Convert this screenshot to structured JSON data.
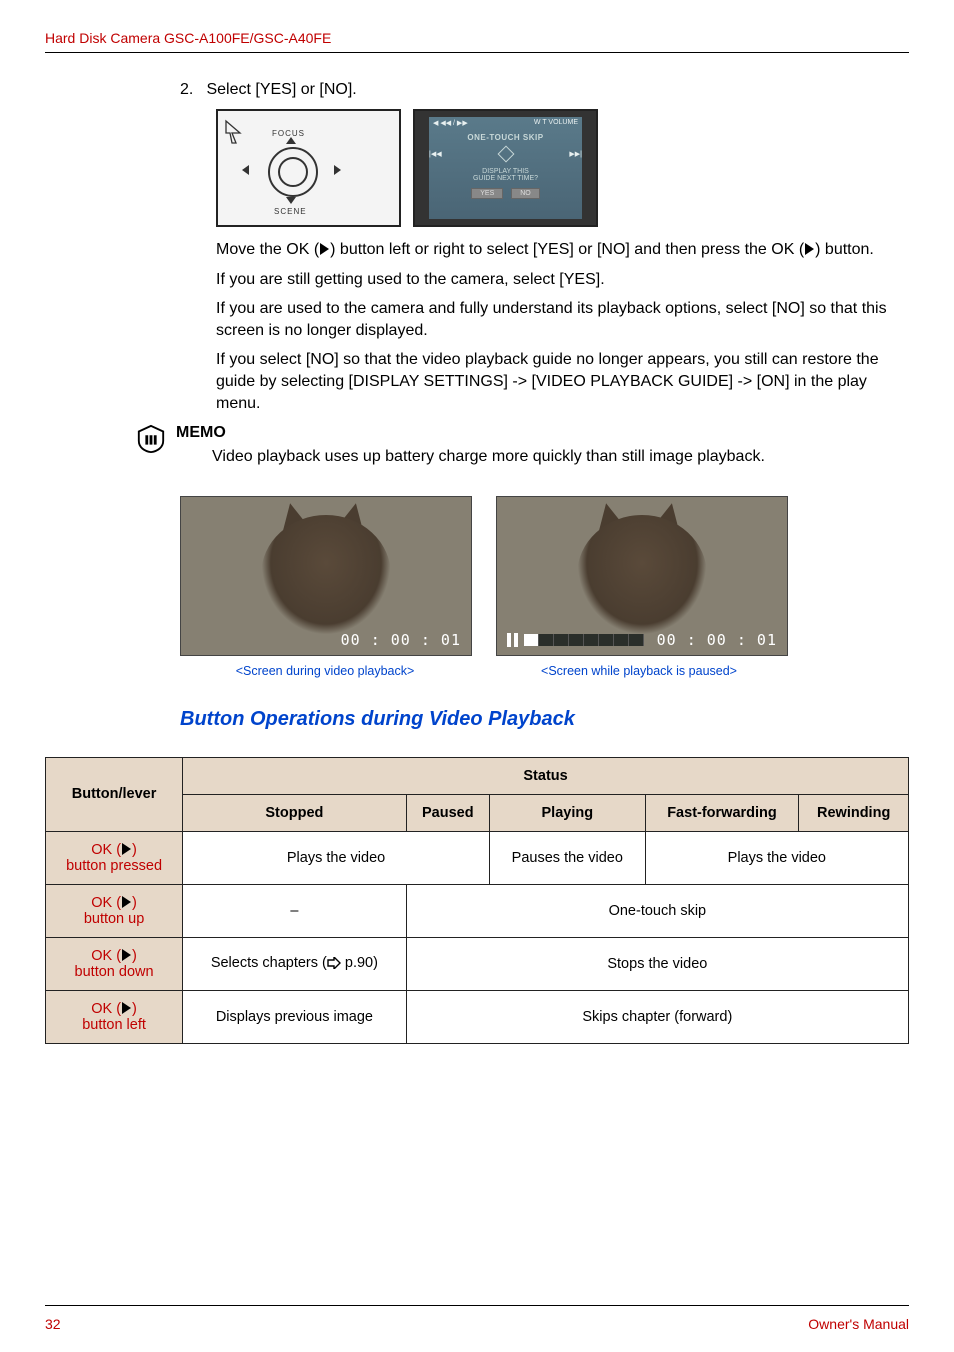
{
  "header": {
    "title": "Hard Disk Camera GSC-A100FE/GSC-A40FE"
  },
  "step": {
    "number": "2.",
    "text": "Select [YES] or [NO]."
  },
  "dial": {
    "top_label": "FOCUS",
    "bottom_label": "SCENE"
  },
  "guide_screen": {
    "top_left_icons": "◀ ◀◀ / ▶▶",
    "top_right": "W T VOLUME",
    "heading": "ONE-TOUCH SKIP",
    "line2a": "DISPLAY THIS",
    "line2b": "GUIDE NEXT TIME?",
    "yes": "YES",
    "no": "NO"
  },
  "paragraphs": {
    "p1a": "Move the OK (",
    "p1b": ") button left or right to select [YES] or [NO] and then press the OK (",
    "p1c": ") button.",
    "p2": "If you are still getting used to the camera, select [YES].",
    "p3": "If you are used to the camera and fully understand its playback options, select [NO] so that this screen is no longer displayed.",
    "p4": "If you select [NO] so that the video playback guide no longer appears, you still can restore the guide by selecting [DISPLAY SETTINGS] -> [VIDEO PLAYBACK GUIDE] -> [ON] in the play menu."
  },
  "memo": {
    "title": "MEMO",
    "text": "Video playback uses up battery charge more quickly than still image playback."
  },
  "timecode": "00 : 00 : 01",
  "captions": {
    "left": "<Screen during video playback>",
    "right": "<Screen while playback is paused>"
  },
  "section_title": "Button Operations during Video Playback",
  "table": {
    "status_header": "Status",
    "col_button": "Button/lever",
    "cols": [
      "Stopped",
      "Paused",
      "Playing",
      "Fast-forwarding",
      "Rewinding"
    ],
    "rows": [
      {
        "label_prefix": "OK (",
        "label_suffix": ")",
        "label_line2": "button pressed",
        "c1": "Plays the video",
        "c2": "Pauses the video",
        "c3": "Plays the video"
      },
      {
        "label_prefix": "OK (",
        "label_suffix": ")",
        "label_line2": "button up",
        "c1": "–",
        "c2": "One-touch skip"
      },
      {
        "label_prefix": "OK (",
        "label_suffix": ")",
        "label_line2": "button down",
        "c1a": "Selects chapters (",
        "c1b": " p.90)",
        "c2": "Stops the video"
      },
      {
        "label_prefix": "OK (",
        "label_suffix": ")",
        "label_line2": "button left",
        "c1": "Displays previous image",
        "c2": "Skips chapter (forward)"
      }
    ]
  },
  "footer": {
    "page": "32",
    "label": "Owner's Manual"
  }
}
